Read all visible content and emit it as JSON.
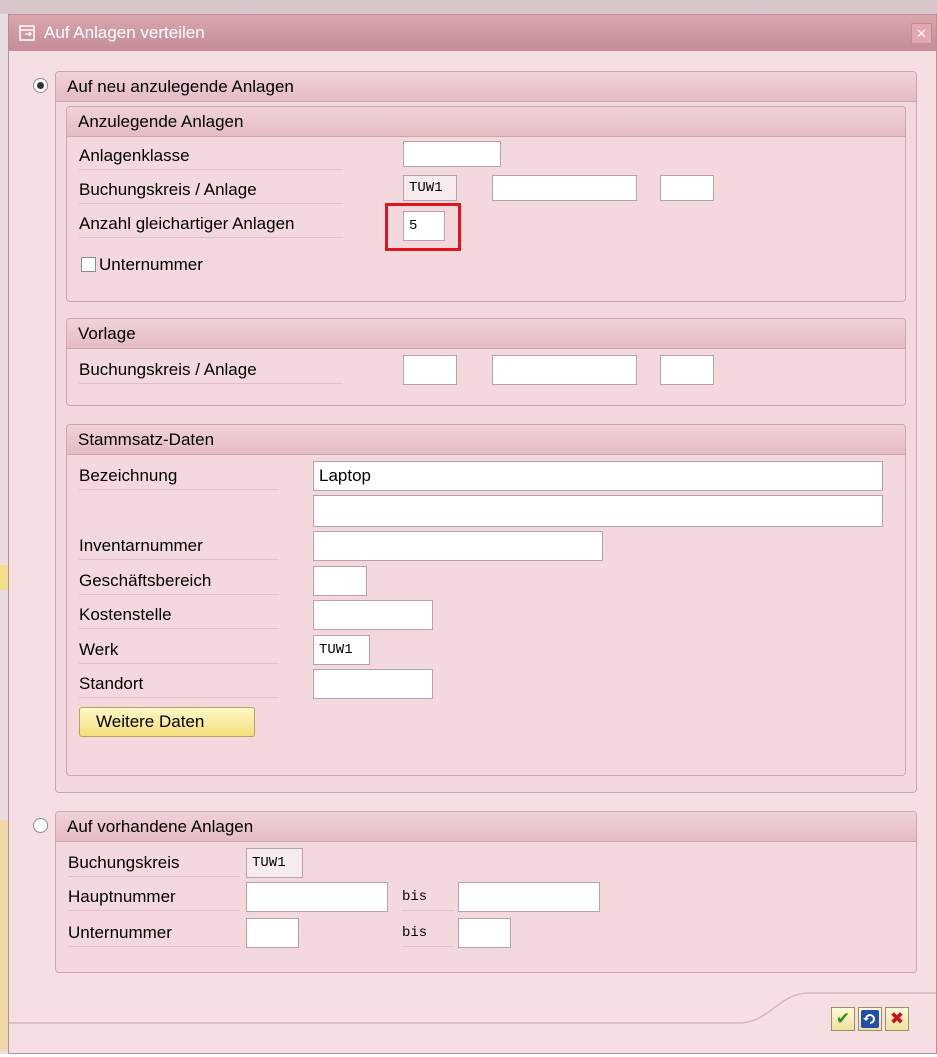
{
  "dialog": {
    "title": "Auf Anlagen verteilen",
    "close_glyph": "✕"
  },
  "option_new": {
    "label": "Auf neu anzulegende Anlagen",
    "selected": true,
    "anzulegende": {
      "title": "Anzulegende Anlagen",
      "anlagenklasse_label": "Anlagenklasse",
      "anlagenklasse_value": "",
      "bukrs_label": "Buchungskreis / Anlage",
      "bukrs_value": "TUW1",
      "anlage_value": "",
      "sub_value": "",
      "anzahl_label": "Anzahl gleichartiger Anlagen",
      "anzahl_value": "5",
      "unternummer_label": "Unternummer",
      "unternummer_checked": false
    },
    "vorlage": {
      "title": "Vorlage",
      "bukrs_label": "Buchungskreis / Anlage",
      "bukrs_value": "",
      "anlage_value": "",
      "sub_value": ""
    },
    "stammsatz": {
      "title": "Stammsatz-Daten",
      "bezeichnung_label": "Bezeichnung",
      "bezeichnung_value": "Laptop",
      "bezeichnung2_value": "",
      "inventar_label": "Inventarnummer",
      "inventar_value": "",
      "gsber_label": "Geschäftsbereich",
      "gsber_value": "",
      "kostl_label": "Kostenstelle",
      "kostl_value": "",
      "werk_label": "Werk",
      "werk_value": "TUW1",
      "standort_label": "Standort",
      "standort_value": "",
      "weitere_button": "Weitere Daten"
    }
  },
  "option_existing": {
    "label": "Auf vorhandene Anlagen",
    "selected": false,
    "bukrs_label": "Buchungskreis",
    "bukrs_value": "TUW1",
    "hauptnummer_label": "Hauptnummer",
    "hauptnummer_from": "",
    "bis_label": "bis",
    "hauptnummer_to": "",
    "unternummer_label": "Unternummer",
    "unternummer_from": "",
    "unternummer_to": ""
  },
  "footer": {
    "confirm_icon": "check-icon",
    "refresh_icon": "refresh-icon",
    "cancel_icon": "cancel-icon",
    "confirm_glyph": "✔",
    "cancel_glyph": "✖"
  },
  "colors": {
    "highlight": "#e0141c",
    "title_bar": "#c48d97",
    "dialog_bg": "#f5dfe3"
  }
}
